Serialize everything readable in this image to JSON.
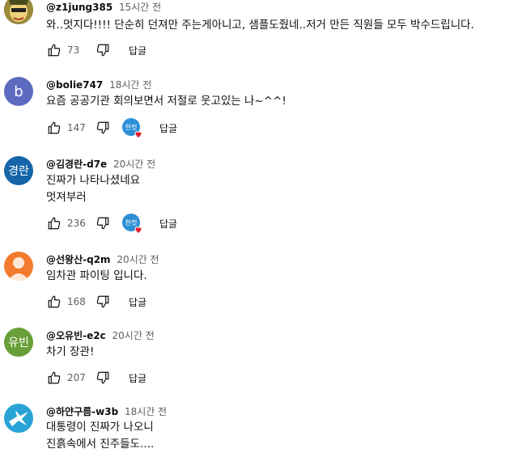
{
  "comments": [
    {
      "author": "@z1jung385",
      "time": "15시간 전",
      "lines": [
        "와..멋지다!!!! 단순히 던져만 주는게아니고, 샘플도줬네..저거 만든 직원들 모두 박수드립니다."
      ],
      "likes": "73",
      "reply": "답글",
      "avatar": {
        "kind": "image",
        "text": "",
        "color": "#6b6b2e"
      }
    },
    {
      "author": "@bolie747",
      "time": "18시간 전",
      "lines": [
        "요즘 공공기관 회의보면서 저절로 웃고있는 나~^^!"
      ],
      "likes": "147",
      "reply": "답글",
      "avatar": {
        "kind": "letter",
        "text": "b",
        "color": "#5c6bc0"
      },
      "creator_heart": true
    },
    {
      "author": "@김경란-d7e",
      "time": "20시간 전",
      "lines": [
        "진짜가 나타나셨네요",
        "멋져부러"
      ],
      "likes": "236",
      "reply": "답글",
      "avatar": {
        "kind": "letter",
        "text": "경란",
        "color": "#1565a8"
      },
      "creator_heart": true
    },
    {
      "author": "@선왕산-q2m",
      "time": "20시간 전",
      "lines": [
        "임차관 파이팅 입니다."
      ],
      "likes": "168",
      "reply": "답글",
      "avatar": {
        "kind": "person",
        "text": "",
        "color": "#f27b2e"
      }
    },
    {
      "author": "@오유빈-e2c",
      "time": "20시간 전",
      "lines": [
        "차기 장관!"
      ],
      "likes": "207",
      "reply": "답글",
      "avatar": {
        "kind": "letter",
        "text": "유빈",
        "color": "#689f38"
      }
    },
    {
      "author": "@하얀구름-w3b",
      "time": "18시간 전",
      "lines": [
        "대통령이 진짜가 나오니",
        "진흙속에서 진주들도...."
      ],
      "likes": "",
      "reply": "",
      "avatar": {
        "kind": "bird",
        "text": "",
        "color": "#29a3d6"
      }
    }
  ],
  "creator_heart_badge": "한컷",
  "colors": {
    "heart": "#e31e2e",
    "meta_text": "#606060"
  }
}
